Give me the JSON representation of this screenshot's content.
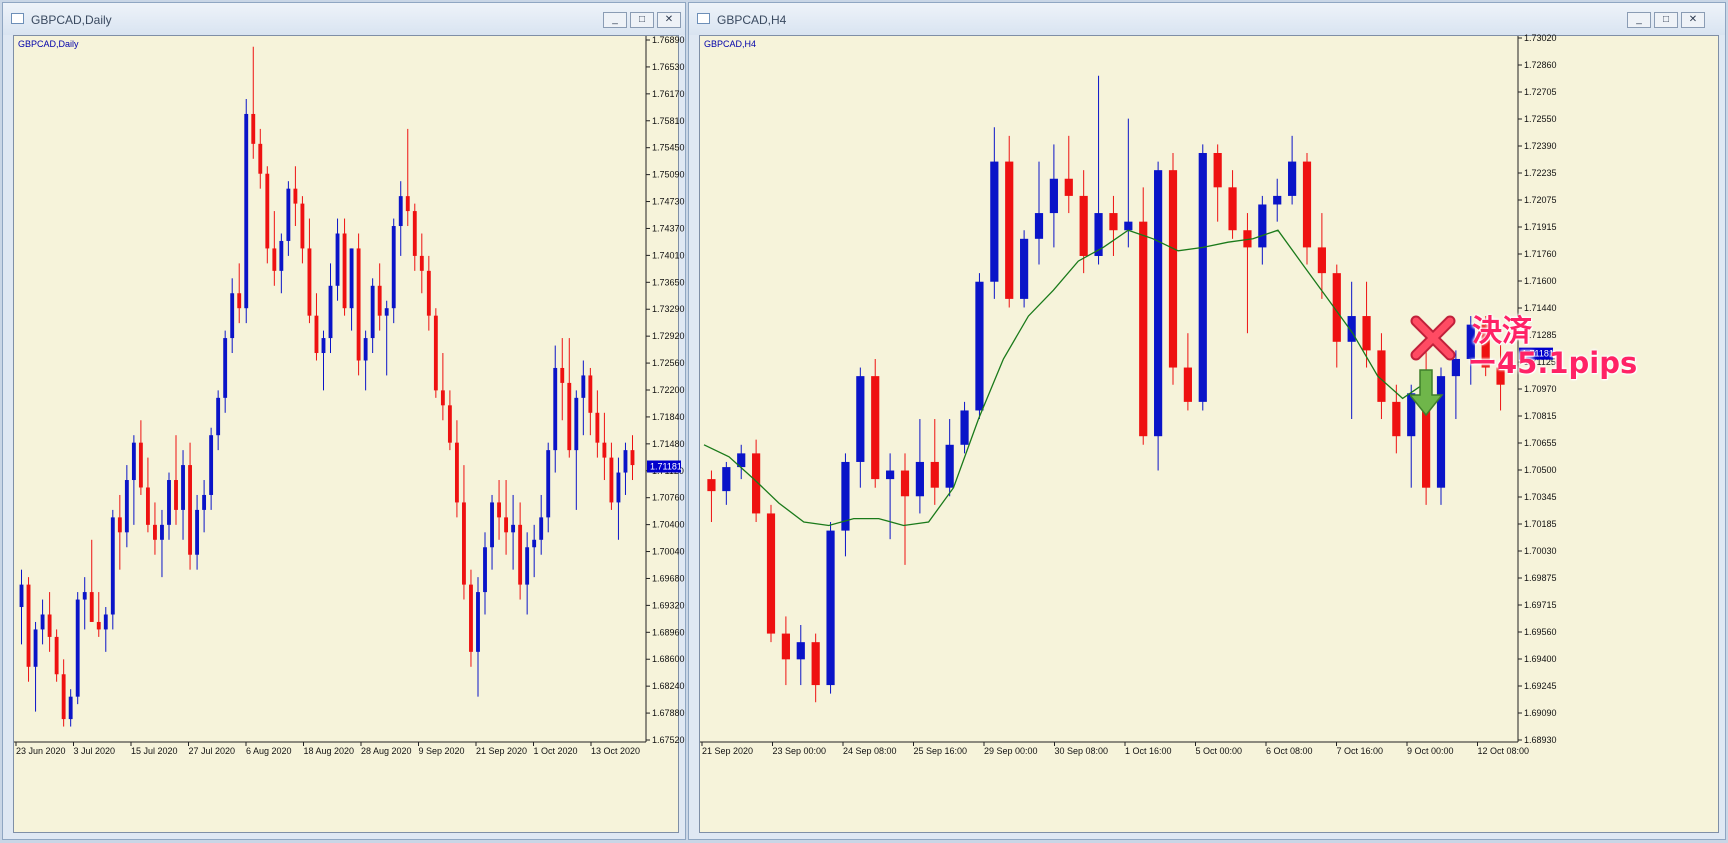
{
  "windows": [
    {
      "title": "GBPCAD,Daily",
      "chart_label": "GBPCAD,Daily",
      "buttons": [
        "_",
        "□",
        "✕"
      ]
    },
    {
      "title": "GBPCAD,H4",
      "chart_label": "GBPCAD,H4",
      "buttons": [
        "_",
        "□",
        "✕"
      ]
    }
  ],
  "annotation": {
    "line1": "決済",
    "line2": "ー45.1pips"
  },
  "colors": {
    "bull": "#0a14c8",
    "bear": "#ee1111",
    "ma": "#1a7a1a",
    "price_box": "#0000cc",
    "background": "#f6f3da"
  },
  "icons": [
    "window-icon",
    "minimize-icon",
    "maximize-icon",
    "close-icon",
    "exit-x-icon",
    "down-arrow-icon"
  ],
  "chart_data": [
    {
      "type": "candlestick",
      "symbol": "GBPCAD",
      "timeframe": "Daily",
      "ylim": [
        1.6752,
        1.7689
      ],
      "y_ticks": [
        "1.76890",
        "1.76530",
        "1.76170",
        "1.75810",
        "1.75450",
        "1.75090",
        "1.74730",
        "1.74370",
        "1.74010",
        "1.73650",
        "1.73290",
        "1.72920",
        "1.72560",
        "1.72200",
        "1.71840",
        "1.71480",
        "1.71120",
        "1.70760",
        "1.70400",
        "1.70040",
        "1.69680",
        "1.69320",
        "1.68960",
        "1.68600",
        "1.68240",
        "1.67880",
        "1.67520"
      ],
      "x_ticks": [
        "23 Jun 2020",
        "3 Jul 2020",
        "15 Jul 2020",
        "27 Jul 2020",
        "6 Aug 2020",
        "18 Aug 2020",
        "28 Aug 2020",
        "9 Sep 2020",
        "21 Sep 2020",
        "1 Oct 2020",
        "13 Oct 2020"
      ],
      "current_price": "1.71181",
      "candles": [
        [
          1.693,
          1.698,
          1.688,
          1.696
        ],
        [
          1.696,
          1.697,
          1.683,
          1.685
        ],
        [
          1.685,
          1.691,
          1.679,
          1.69
        ],
        [
          1.69,
          1.694,
          1.688,
          1.692
        ],
        [
          1.692,
          1.695,
          1.687,
          1.689
        ],
        [
          1.689,
          1.69,
          1.683,
          1.684
        ],
        [
          1.684,
          1.686,
          1.677,
          1.678
        ],
        [
          1.678,
          1.682,
          1.677,
          1.681
        ],
        [
          1.681,
          1.695,
          1.68,
          1.694
        ],
        [
          1.694,
          1.697,
          1.69,
          1.695
        ],
        [
          1.695,
          1.702,
          1.692,
          1.691
        ],
        [
          1.691,
          1.695,
          1.689,
          1.69
        ],
        [
          1.69,
          1.693,
          1.687,
          1.692
        ],
        [
          1.692,
          1.706,
          1.69,
          1.705
        ],
        [
          1.705,
          1.708,
          1.698,
          1.703
        ],
        [
          1.703,
          1.712,
          1.701,
          1.71
        ],
        [
          1.71,
          1.716,
          1.704,
          1.715
        ],
        [
          1.715,
          1.718,
          1.708,
          1.709
        ],
        [
          1.709,
          1.713,
          1.703,
          1.704
        ],
        [
          1.704,
          1.707,
          1.7,
          1.702
        ],
        [
          1.702,
          1.706,
          1.697,
          1.704
        ],
        [
          1.704,
          1.711,
          1.702,
          1.71
        ],
        [
          1.71,
          1.716,
          1.704,
          1.706
        ],
        [
          1.706,
          1.714,
          1.702,
          1.712
        ],
        [
          1.712,
          1.715,
          1.698,
          1.7
        ],
        [
          1.7,
          1.708,
          1.698,
          1.706
        ],
        [
          1.706,
          1.71,
          1.703,
          1.708
        ],
        [
          1.708,
          1.717,
          1.706,
          1.716
        ],
        [
          1.716,
          1.722,
          1.714,
          1.721
        ],
        [
          1.721,
          1.73,
          1.719,
          1.729
        ],
        [
          1.729,
          1.737,
          1.727,
          1.735
        ],
        [
          1.735,
          1.739,
          1.731,
          1.733
        ],
        [
          1.733,
          1.761,
          1.731,
          1.759
        ],
        [
          1.759,
          1.768,
          1.753,
          1.755
        ],
        [
          1.755,
          1.757,
          1.749,
          1.751
        ],
        [
          1.751,
          1.752,
          1.739,
          1.741
        ],
        [
          1.741,
          1.746,
          1.736,
          1.738
        ],
        [
          1.738,
          1.743,
          1.735,
          1.742
        ],
        [
          1.742,
          1.75,
          1.74,
          1.749
        ],
        [
          1.749,
          1.752,
          1.744,
          1.747
        ],
        [
          1.747,
          1.748,
          1.739,
          1.741
        ],
        [
          1.741,
          1.745,
          1.731,
          1.732
        ],
        [
          1.732,
          1.735,
          1.726,
          1.727
        ],
        [
          1.727,
          1.73,
          1.722,
          1.729
        ],
        [
          1.729,
          1.739,
          1.727,
          1.736
        ],
        [
          1.736,
          1.745,
          1.734,
          1.743
        ],
        [
          1.743,
          1.745,
          1.732,
          1.733
        ],
        [
          1.733,
          1.741,
          1.73,
          1.741
        ],
        [
          1.741,
          1.743,
          1.724,
          1.726
        ],
        [
          1.726,
          1.73,
          1.722,
          1.729
        ],
        [
          1.729,
          1.737,
          1.727,
          1.736
        ],
        [
          1.736,
          1.739,
          1.73,
          1.732
        ],
        [
          1.732,
          1.734,
          1.724,
          1.733
        ],
        [
          1.733,
          1.745,
          1.731,
          1.744
        ],
        [
          1.744,
          1.75,
          1.74,
          1.748
        ],
        [
          1.748,
          1.757,
          1.744,
          1.746
        ],
        [
          1.746,
          1.747,
          1.738,
          1.74
        ],
        [
          1.74,
          1.743,
          1.735,
          1.738
        ],
        [
          1.738,
          1.74,
          1.73,
          1.732
        ],
        [
          1.732,
          1.733,
          1.721,
          1.722
        ],
        [
          1.722,
          1.727,
          1.718,
          1.72
        ],
        [
          1.72,
          1.722,
          1.714,
          1.715
        ],
        [
          1.715,
          1.718,
          1.705,
          1.707
        ],
        [
          1.707,
          1.712,
          1.694,
          1.696
        ],
        [
          1.696,
          1.698,
          1.685,
          1.687
        ],
        [
          1.687,
          1.697,
          1.681,
          1.695
        ],
        [
          1.695,
          1.703,
          1.692,
          1.701
        ],
        [
          1.701,
          1.708,
          1.698,
          1.707
        ],
        [
          1.707,
          1.71,
          1.702,
          1.705
        ],
        [
          1.705,
          1.71,
          1.7,
          1.703
        ],
        [
          1.703,
          1.708,
          1.698,
          1.704
        ],
        [
          1.704,
          1.707,
          1.694,
          1.696
        ],
        [
          1.696,
          1.703,
          1.692,
          1.701
        ],
        [
          1.701,
          1.704,
          1.697,
          1.702
        ],
        [
          1.702,
          1.708,
          1.7,
          1.705
        ],
        [
          1.705,
          1.715,
          1.703,
          1.714
        ],
        [
          1.714,
          1.728,
          1.711,
          1.725
        ],
        [
          1.725,
          1.729,
          1.718,
          1.723
        ],
        [
          1.723,
          1.729,
          1.713,
          1.714
        ],
        [
          1.714,
          1.722,
          1.706,
          1.721
        ],
        [
          1.721,
          1.726,
          1.716,
          1.724
        ],
        [
          1.724,
          1.725,
          1.716,
          1.719
        ],
        [
          1.719,
          1.722,
          1.713,
          1.715
        ],
        [
          1.715,
          1.719,
          1.71,
          1.713
        ],
        [
          1.713,
          1.715,
          1.706,
          1.707
        ],
        [
          1.707,
          1.713,
          1.702,
          1.711
        ],
        [
          1.711,
          1.715,
          1.708,
          1.714
        ],
        [
          1.714,
          1.716,
          1.71,
          1.712
        ]
      ]
    },
    {
      "type": "candlestick",
      "symbol": "GBPCAD",
      "timeframe": "H4",
      "ylim": [
        1.6893,
        1.7302
      ],
      "y_ticks": [
        "1.73020",
        "1.72860",
        "1.72705",
        "1.72550",
        "1.72390",
        "1.72235",
        "1.72075",
        "1.71915",
        "1.71760",
        "1.71600",
        "1.71440",
        "1.71285",
        "1.71125",
        "1.70970",
        "1.70815",
        "1.70655",
        "1.70500",
        "1.70345",
        "1.70185",
        "1.70030",
        "1.69875",
        "1.69715",
        "1.69560",
        "1.69400",
        "1.69245",
        "1.69090",
        "1.68930"
      ],
      "x_ticks": [
        "21 Sep 2020",
        "23 Sep 00:00",
        "24 Sep 08:00",
        "25 Sep 16:00",
        "29 Sep 00:00",
        "30 Sep 08:00",
        "1 Oct 16:00",
        "5 Oct 00:00",
        "6 Oct 08:00",
        "7 Oct 16:00",
        "9 Oct 00:00",
        "12 Oct 08:00"
      ],
      "current_price": "1.71181",
      "moving_average": [
        1.7065,
        1.7058,
        1.7045,
        1.7031,
        1.702,
        1.7018,
        1.7022,
        1.7022,
        1.7018,
        1.702,
        1.704,
        1.708,
        1.7115,
        1.714,
        1.7155,
        1.7172,
        1.718,
        1.719,
        1.7185,
        1.7178,
        1.718,
        1.7183,
        1.7185,
        1.719,
        1.717,
        1.715,
        1.713,
        1.7105,
        1.7092,
        1.7102
      ],
      "candles": [
        [
          1.7045,
          1.705,
          1.702,
          1.7038
        ],
        [
          1.7038,
          1.7055,
          1.703,
          1.7052
        ],
        [
          1.7052,
          1.7065,
          1.7045,
          1.706
        ],
        [
          1.706,
          1.7068,
          1.702,
          1.7025
        ],
        [
          1.7025,
          1.703,
          1.695,
          1.6955
        ],
        [
          1.6955,
          1.6965,
          1.6925,
          1.694
        ],
        [
          1.694,
          1.696,
          1.6925,
          1.695
        ],
        [
          1.695,
          1.6955,
          1.6915,
          1.6925
        ],
        [
          1.6925,
          1.702,
          1.692,
          1.7015
        ],
        [
          1.7015,
          1.706,
          1.7,
          1.7055
        ],
        [
          1.7055,
          1.711,
          1.704,
          1.7105
        ],
        [
          1.7105,
          1.7115,
          1.704,
          1.7045
        ],
        [
          1.7045,
          1.706,
          1.701,
          1.705
        ],
        [
          1.705,
          1.706,
          1.6995,
          1.7035
        ],
        [
          1.7035,
          1.708,
          1.7025,
          1.7055
        ],
        [
          1.7055,
          1.708,
          1.703,
          1.704
        ],
        [
          1.704,
          1.708,
          1.7035,
          1.7065
        ],
        [
          1.7065,
          1.709,
          1.706,
          1.7085
        ],
        [
          1.7085,
          1.7165,
          1.708,
          1.716
        ],
        [
          1.716,
          1.725,
          1.715,
          1.723
        ],
        [
          1.723,
          1.7245,
          1.7145,
          1.715
        ],
        [
          1.715,
          1.719,
          1.7145,
          1.7185
        ],
        [
          1.7185,
          1.723,
          1.717,
          1.72
        ],
        [
          1.72,
          1.724,
          1.718,
          1.722
        ],
        [
          1.722,
          1.7245,
          1.72,
          1.721
        ],
        [
          1.721,
          1.7225,
          1.7165,
          1.7175
        ],
        [
          1.7175,
          1.728,
          1.717,
          1.72
        ],
        [
          1.72,
          1.721,
          1.7175,
          1.719
        ],
        [
          1.719,
          1.7255,
          1.718,
          1.7195
        ],
        [
          1.7195,
          1.7215,
          1.7065,
          1.707
        ],
        [
          1.707,
          1.723,
          1.705,
          1.7225
        ],
        [
          1.7225,
          1.7235,
          1.71,
          1.711
        ],
        [
          1.711,
          1.713,
          1.7085,
          1.709
        ],
        [
          1.709,
          1.724,
          1.7085,
          1.7235
        ],
        [
          1.7235,
          1.724,
          1.7195,
          1.7215
        ],
        [
          1.7215,
          1.7225,
          1.7185,
          1.719
        ],
        [
          1.719,
          1.72,
          1.713,
          1.718
        ],
        [
          1.718,
          1.721,
          1.717,
          1.7205
        ],
        [
          1.7205,
          1.722,
          1.7195,
          1.721
        ],
        [
          1.721,
          1.7245,
          1.7205,
          1.723
        ],
        [
          1.723,
          1.7235,
          1.717,
          1.718
        ],
        [
          1.718,
          1.72,
          1.715,
          1.7165
        ],
        [
          1.7165,
          1.717,
          1.711,
          1.7125
        ],
        [
          1.7125,
          1.716,
          1.708,
          1.714
        ],
        [
          1.714,
          1.716,
          1.711,
          1.712
        ],
        [
          1.712,
          1.713,
          1.708,
          1.709
        ],
        [
          1.709,
          1.71,
          1.706,
          1.707
        ],
        [
          1.707,
          1.71,
          1.704,
          1.7095
        ],
        [
          1.7095,
          1.712,
          1.703,
          1.704
        ],
        [
          1.704,
          1.711,
          1.703,
          1.7105
        ],
        [
          1.7105,
          1.712,
          1.708,
          1.7115
        ],
        [
          1.7115,
          1.714,
          1.71,
          1.7135
        ],
        [
          1.7135,
          1.714,
          1.7105,
          1.711
        ],
        [
          1.711,
          1.7125,
          1.7085,
          1.71
        ]
      ]
    }
  ]
}
